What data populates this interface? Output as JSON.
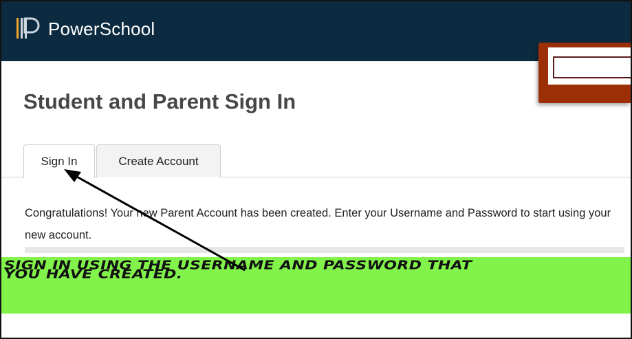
{
  "header": {
    "brand_name": "PowerSchool",
    "logo_icon": "powerschool-logo-icon",
    "bar_color": "#0c2b40"
  },
  "page": {
    "title": "Student and Parent Sign In"
  },
  "tabs": [
    {
      "label": "Sign In",
      "active": true
    },
    {
      "label": "Create Account",
      "active": false
    }
  ],
  "message": {
    "text": "Congratulations! Your new Parent Account has been created. Enter your Username and Password to start using your new account."
  },
  "annotation": {
    "callout_text": "Sign in using the username and password that you have created.",
    "highlight_color": "#82f34a",
    "arrow_icon": "arrow-icon"
  }
}
